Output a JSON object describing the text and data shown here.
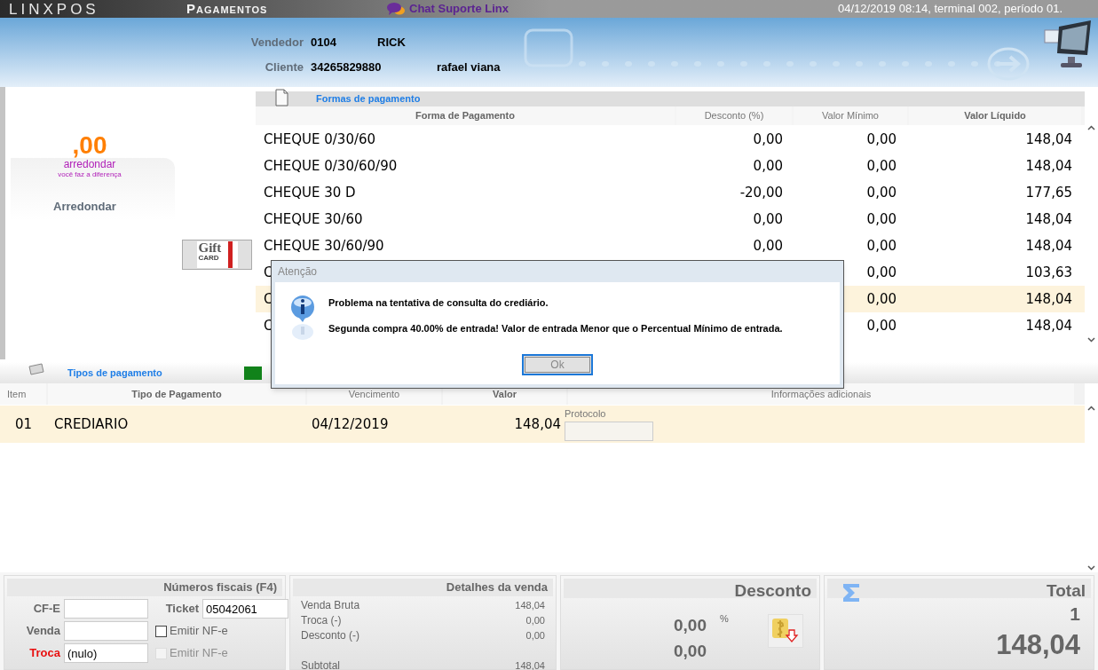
{
  "title_bar": {
    "logo": "LINXPOS",
    "title": "Pagamentos",
    "chat": "Chat Suporte Linx",
    "session": "04/12/2019 08:14, terminal 002, período 01."
  },
  "header": {
    "seller_label": "Vendedor",
    "seller_code": "0104",
    "seller_name": "RICK",
    "client_label": "Cliente",
    "client_code": "34265829880",
    "client_name": "rafael viana"
  },
  "rounding": {
    "amount": ",00",
    "brand": "arredondar",
    "tagline": "você faz a diferença",
    "button": "Arredondar"
  },
  "gift_card": {
    "text": "Gift",
    "sub": "CARD"
  },
  "payment_forms": {
    "title": "Formas de pagamento",
    "columns": [
      "Forma de Pagamento",
      "Desconto (%)",
      "Valor Mínimo",
      "Valor Líquido"
    ],
    "rows": [
      {
        "name": "CHEQUE 0/30/60",
        "discount": "0,00",
        "minimum": "0,00",
        "net": "148,04",
        "selected": false
      },
      {
        "name": "CHEQUE 0/30/60/90",
        "discount": "0,00",
        "minimum": "0,00",
        "net": "148,04",
        "selected": false
      },
      {
        "name": "CHEQUE 30 D",
        "discount": "-20,00",
        "minimum": "0,00",
        "net": "177,65",
        "selected": false
      },
      {
        "name": "CHEQUE 30/60",
        "discount": "0,00",
        "minimum": "0,00",
        "net": "148,04",
        "selected": false
      },
      {
        "name": "CHEQUE 30/60/90",
        "discount": "0,00",
        "minimum": "0,00",
        "net": "148,04",
        "selected": false
      },
      {
        "name": "C",
        "minimum": "0,00",
        "net": "103,63",
        "selected": false
      },
      {
        "name": "C",
        "minimum": "0,00",
        "net": "148,04",
        "selected": true
      },
      {
        "name": "C",
        "minimum": "0,00",
        "net": "148,04",
        "selected": false
      }
    ]
  },
  "payment_types": {
    "title": "Tipos de pagamento",
    "columns": [
      "Item",
      "Tipo de Pagamento",
      "Vencimento",
      "Valor",
      "Informações adicionais"
    ],
    "rows": [
      {
        "item": "01",
        "type": "CREDIARIO",
        "due": "04/12/2019",
        "value": "148,04",
        "extra_label": "Protocolo",
        "selected": true
      }
    ]
  },
  "fiscal": {
    "title": "Números fiscais (F4)",
    "cfe_label": "CF-E",
    "ticket_label": "Ticket",
    "ticket_value": "05042061",
    "sale_label": "Venda",
    "exchange_label": "Troca",
    "exchange_value": "(nulo)",
    "checkboxes": [
      {
        "label": "Emitir NF-e",
        "checked": false,
        "disabled": false
      },
      {
        "label": "Emitir NF-e",
        "checked": false,
        "disabled": true
      }
    ]
  },
  "sale_details": {
    "title": "Detalhes da venda",
    "lines": [
      {
        "label": "Venda Bruta",
        "value": "148,04"
      },
      {
        "label": "Troca (-)",
        "value": "0,00"
      },
      {
        "label": "Desconto (-)",
        "value": "0,00"
      }
    ],
    "subtotal_label": "Subtotal",
    "subtotal_value": "148,04"
  },
  "discount": {
    "title": "Desconto",
    "percent": "0,00",
    "percent_sign": "%",
    "amount": "0,00"
  },
  "total": {
    "title": "Total",
    "count": "1",
    "amount": "148,04"
  },
  "dialog": {
    "title": "Atenção",
    "messages": [
      "Problema na tentativa de consulta do crediário.",
      "Segunda compra 40.00% de entrada! Valor de entrada Menor que o Percentual Mínimo de entrada."
    ],
    "ok": "Ok"
  }
}
